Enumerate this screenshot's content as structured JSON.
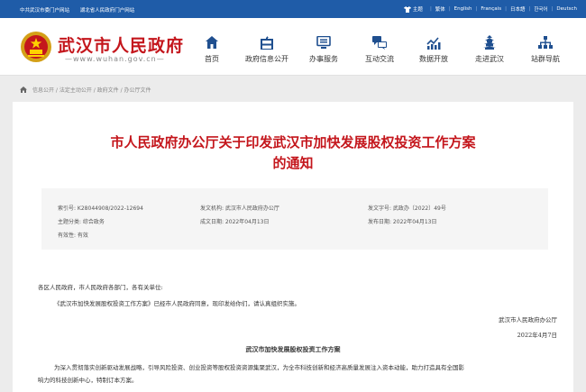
{
  "topbar": {
    "left_links": [
      "中共武汉市委门户网站",
      "湖北省人民政府门户网站"
    ],
    "theme_label": "主题",
    "languages": [
      "繁体",
      "English",
      "Français",
      "日本語",
      "한국어",
      "Deutsch"
    ]
  },
  "header": {
    "site_title": "武汉市人民政府",
    "site_url": "—www.wuhan.gov.cn—",
    "nav": [
      {
        "label": "首页",
        "icon": "home-icon"
      },
      {
        "label": "政府信息公开",
        "icon": "government-building-icon"
      },
      {
        "label": "办事服务",
        "icon": "service-desk-icon"
      },
      {
        "label": "互动交流",
        "icon": "interaction-icon"
      },
      {
        "label": "数据开放",
        "icon": "data-chart-icon"
      },
      {
        "label": "走进武汉",
        "icon": "landmark-tower-icon"
      },
      {
        "label": "站群导航",
        "icon": "site-map-icon"
      }
    ]
  },
  "breadcrumb": "信息公开 / 法定主动公开 / 政府文件 / 办公厅文件",
  "article": {
    "title_line1": "市人民政府办公厅关于印发武汉市加快发展股权投资工作方案",
    "title_line2": "的通知",
    "meta": {
      "index_no": "索引号:  K28044908/2022-12694",
      "publisher": "发文机构:  武汉市人民政府办公厅",
      "doc_no": "发文字号:  武政办〔2022〕49号",
      "category": "主题分类:  综合政务",
      "created": "成文日期:  2022年04月13日",
      "published": "发布日期:  2022年04月13日",
      "validity": "有效性:  有效"
    },
    "salutation": "各区人民政府，市人民政府各部门，各有关单位:",
    "paragraph1": "《武汉市加快发展股权投资工作方案》已经市人民政府同意，现印发给你们，请认真组织实施。",
    "signer": "武汉市人民政府办公厅",
    "date": "2022年4月7日",
    "doc_heading": "武汉市加快发展股权投资工作方案",
    "paragraph2_line1": "为深入贯彻落实创新驱动发展战略，引导风险投资、创业投资等股权投资资源集聚武汉，为全市科技创新和经济高质量发展注入资本动能，助力打造具有全国影",
    "paragraph2_line2": "响力的科技创新中心，特制订本方案。"
  },
  "colors": {
    "topbar_bg": "#1f5ca8",
    "brand_red": "#c4161c",
    "nav_icon": "#1f4f8f"
  }
}
